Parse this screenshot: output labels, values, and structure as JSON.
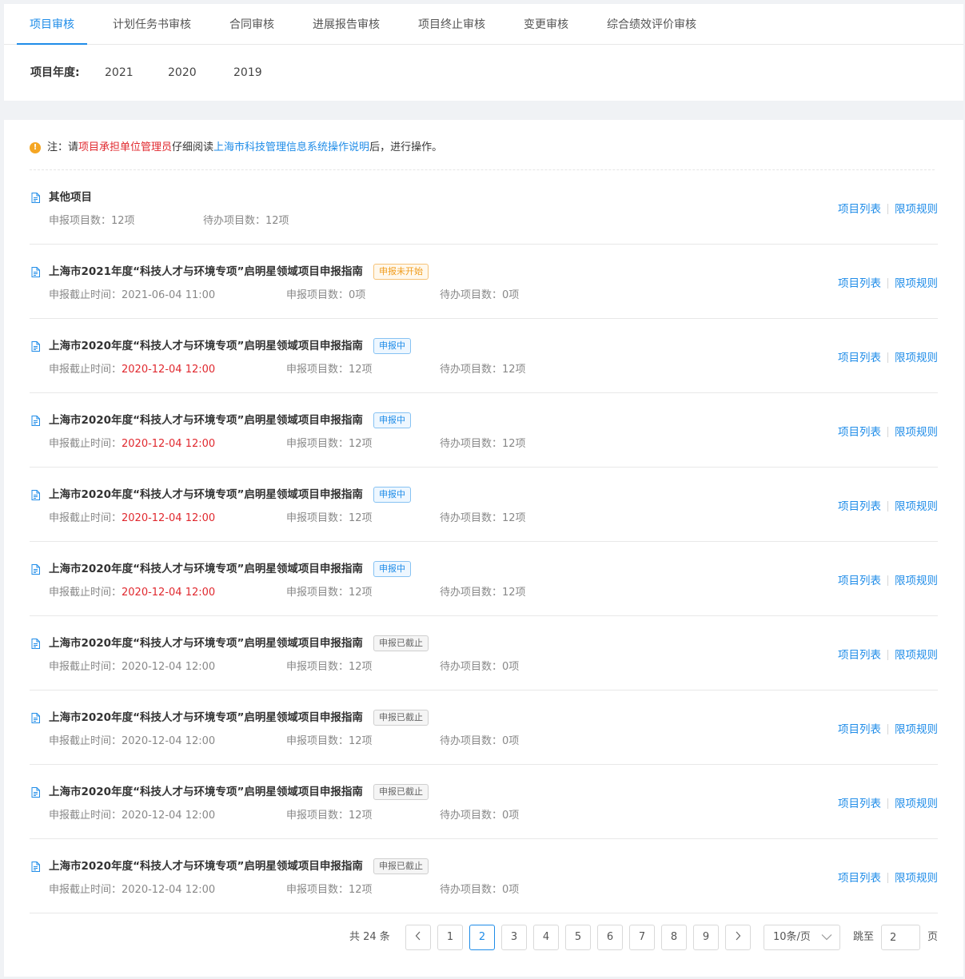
{
  "tabs": [
    {
      "label": "项目审核",
      "active": true
    },
    {
      "label": "计划任务书审核",
      "active": false
    },
    {
      "label": "合同审核",
      "active": false
    },
    {
      "label": "进展报告审核",
      "active": false
    },
    {
      "label": "项目终止审核",
      "active": false
    },
    {
      "label": "变更审核",
      "active": false
    },
    {
      "label": "综合绩效评价审核",
      "active": false
    }
  ],
  "year_filter": {
    "label": "项目年度:",
    "options": [
      "2021",
      "2020",
      "2019"
    ]
  },
  "notice": {
    "icon": "warning-icon",
    "prefix": "注：请",
    "role": "项目承担单位管理员",
    "middle": "仔细阅读",
    "link": "上海市科技管理信息系统操作说明",
    "suffix": "后，进行操作。"
  },
  "actions": {
    "list": "项目列表",
    "rules": "限项规则"
  },
  "labels": {
    "deadline": "申报截止时间：",
    "declared": "申报项目数：",
    "pending": "待办项目数："
  },
  "other_item": {
    "title": "其他项目",
    "declared": "12项",
    "pending": "12项"
  },
  "items": [
    {
      "title": "上海市2021年度“科技人才与环境专项”启明星领域项目申报指南",
      "status": "申报未开始",
      "status_type": "notstarted",
      "deadline": "2021-06-04 11:00",
      "deadline_red": false,
      "declared": "0项",
      "pending": "0项"
    },
    {
      "title": "上海市2020年度“科技人才与环境专项”启明星领域项目申报指南",
      "status": "申报中",
      "status_type": "ongoing",
      "deadline": "2020-12-04 12:00",
      "deadline_red": true,
      "declared": "12项",
      "pending": "12项"
    },
    {
      "title": "上海市2020年度“科技人才与环境专项”启明星领域项目申报指南",
      "status": "申报中",
      "status_type": "ongoing",
      "deadline": "2020-12-04 12:00",
      "deadline_red": true,
      "declared": "12项",
      "pending": "12项"
    },
    {
      "title": "上海市2020年度“科技人才与环境专项”启明星领域项目申报指南",
      "status": "申报中",
      "status_type": "ongoing",
      "deadline": "2020-12-04 12:00",
      "deadline_red": true,
      "declared": "12项",
      "pending": "12项"
    },
    {
      "title": "上海市2020年度“科技人才与环境专项”启明星领域项目申报指南",
      "status": "申报中",
      "status_type": "ongoing",
      "deadline": "2020-12-04 12:00",
      "deadline_red": true,
      "declared": "12项",
      "pending": "12项"
    },
    {
      "title": "上海市2020年度“科技人才与环境专项”启明星领域项目申报指南",
      "status": "申报已截止",
      "status_type": "closed",
      "deadline": "2020-12-04 12:00",
      "deadline_red": false,
      "declared": "12项",
      "pending": "0项"
    },
    {
      "title": "上海市2020年度“科技人才与环境专项”启明星领域项目申报指南",
      "status": "申报已截止",
      "status_type": "closed",
      "deadline": "2020-12-04 12:00",
      "deadline_red": false,
      "declared": "12项",
      "pending": "0项"
    },
    {
      "title": "上海市2020年度“科技人才与环境专项”启明星领域项目申报指南",
      "status": "申报已截止",
      "status_type": "closed",
      "deadline": "2020-12-04 12:00",
      "deadline_red": false,
      "declared": "12项",
      "pending": "0项"
    },
    {
      "title": "上海市2020年度“科技人才与环境专项”启明星领域项目申报指南",
      "status": "申报已截止",
      "status_type": "closed",
      "deadline": "2020-12-04 12:00",
      "deadline_red": false,
      "declared": "12项",
      "pending": "0项"
    }
  ],
  "pagination": {
    "total_text": "共 24 条",
    "pages": [
      "1",
      "2",
      "3",
      "4",
      "5",
      "6",
      "7",
      "8",
      "9"
    ],
    "current": "2",
    "prev_icon": "chevron-left-icon",
    "next_icon": "chevron-right-icon",
    "page_size": "10条/页",
    "jump_label": "跳至",
    "jump_value": "2",
    "page_unit": "页"
  }
}
